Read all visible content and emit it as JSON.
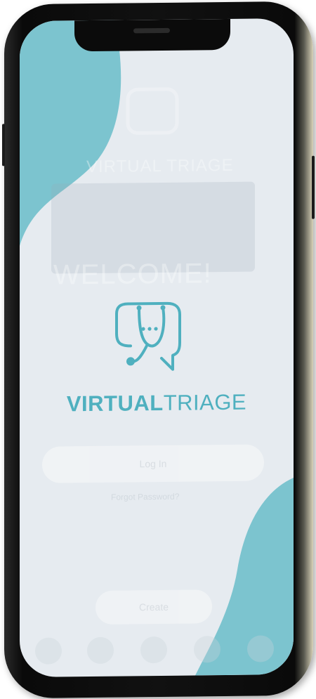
{
  "brand": {
    "name_bold": "VIRTUAL",
    "name_light": "TRIAGE"
  },
  "background_app": {
    "header_brand": "VIRTUAL TRIAGE",
    "welcome_heading": "WELCOME!",
    "login_button": "Log In",
    "create_button": "Create",
    "forgot_link": "Forgot Password?"
  },
  "nav": {
    "items": [
      "home-icon",
      "search-icon",
      "list-icon",
      "mail-icon",
      "user-icon"
    ]
  },
  "colors": {
    "accent": "#4fb0bf",
    "blob": "#7cc4cf",
    "screen_bg": "#e6ebf0"
  }
}
